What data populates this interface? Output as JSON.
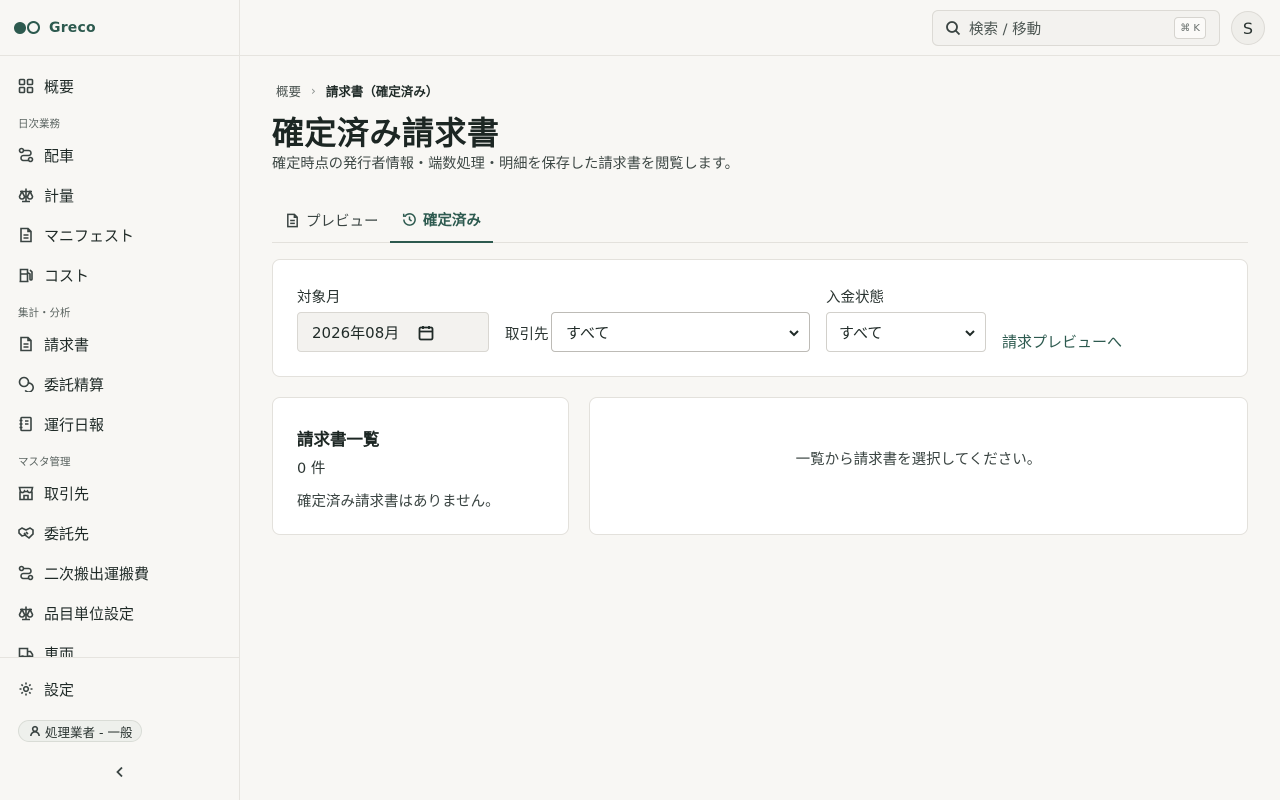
{
  "brand": {
    "name": "Greco",
    "accent": "#2d5a4f"
  },
  "sidebar": {
    "items": [
      {
        "label": "概要",
        "icon": "dashboard-icon"
      },
      {
        "section": "日次業務"
      },
      {
        "label": "配車",
        "icon": "route-icon"
      },
      {
        "label": "計量",
        "icon": "scale-icon"
      },
      {
        "label": "マニフェスト",
        "icon": "document-icon"
      },
      {
        "label": "コスト",
        "icon": "fuel-icon"
      },
      {
        "section": "集計・分析"
      },
      {
        "label": "請求書",
        "icon": "document-icon"
      },
      {
        "label": "委託精算",
        "icon": "coins-icon"
      },
      {
        "label": "運行日報",
        "icon": "notebook-icon"
      },
      {
        "section": "マスタ管理"
      },
      {
        "label": "取引先",
        "icon": "store-icon"
      },
      {
        "label": "委託先",
        "icon": "handshake-icon"
      },
      {
        "label": "二次搬出運搬費",
        "icon": "route-icon"
      },
      {
        "label": "品目単位設定",
        "icon": "scale-icon"
      },
      {
        "label": "車両",
        "icon": "truck-icon"
      }
    ],
    "settings_label": "設定",
    "role_badge": "処理業者 - 一般"
  },
  "topbar": {
    "search_placeholder": "検索 / 移動",
    "shortcut": "⌘ K",
    "avatar_initial": "S"
  },
  "breadcrumb": {
    "parent": "概要",
    "current": "請求書（確定済み）"
  },
  "page": {
    "title": "確定済み請求書",
    "subtitle": "確定時点の発行者情報・端数処理・明細を保存した請求書を閲覧します。"
  },
  "tabs": {
    "preview": "プレビュー",
    "confirmed": "確定済み"
  },
  "filters": {
    "month_label": "対象月",
    "month_value": "2026年08月",
    "client_label": "取引先",
    "client_value": "すべて",
    "payment_label": "入金状態",
    "payment_value": "すべて",
    "preview_link": "請求プレビューへ"
  },
  "list": {
    "title": "請求書一覧",
    "count": "0 件",
    "empty": "確定済み請求書はありません。"
  },
  "detail": {
    "placeholder": "一覧から請求書を選択してください。"
  }
}
